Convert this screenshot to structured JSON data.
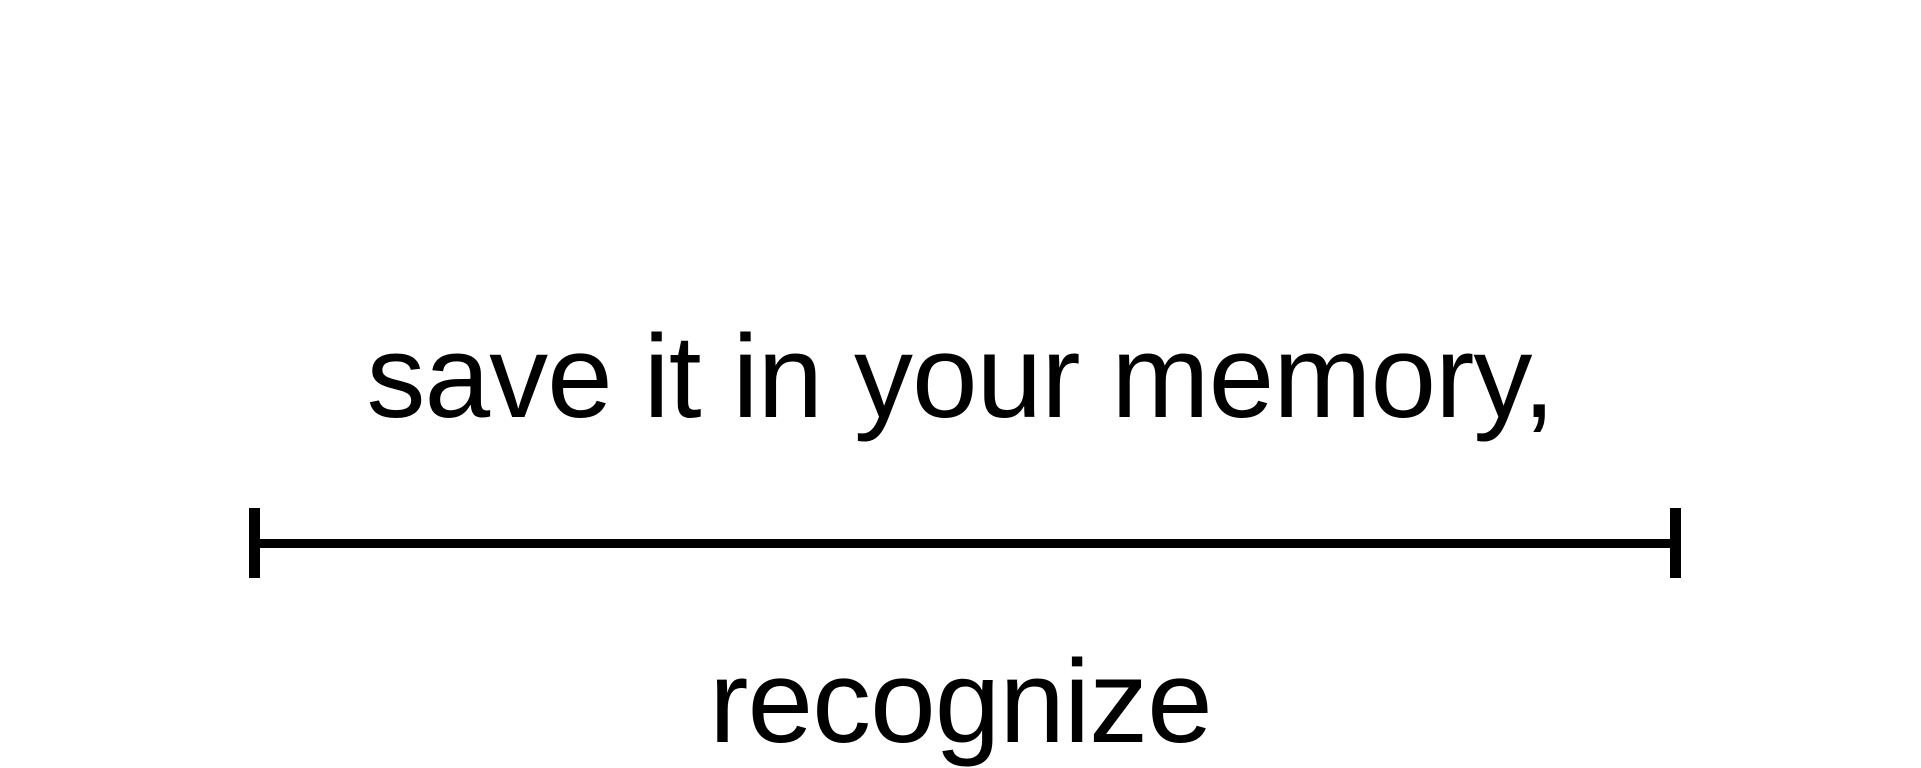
{
  "caption_top": "save it in your memory,",
  "caption_bottom": "recognize",
  "colors": {
    "background": "#ffffff",
    "ink": "#000000"
  }
}
